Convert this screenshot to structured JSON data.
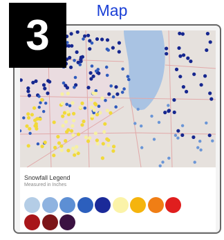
{
  "header": {
    "title": "Map",
    "step_number": "3"
  },
  "map": {
    "colors": {
      "land": "#e6e1dd",
      "land_tint": "#ecd9e2",
      "lake": "#a9c3e3",
      "roads": "#e2a9a9",
      "dot_dark_blue": "#16278f",
      "dot_mid_blue": "#2f5bbd",
      "dot_light_blue": "#6a95d6",
      "dot_yellow": "#f1d93a",
      "dot_pale_yellow": "#f7f0a2"
    }
  },
  "legend": {
    "title": "Snowfall Legend",
    "subtitle": "Measured in Inches",
    "swatches": [
      {
        "label": "",
        "color": "#b4cde6"
      },
      {
        "label": "",
        "color": "#8fb3e0"
      },
      {
        "label": "",
        "color": "#5d8fd4"
      },
      {
        "label": "",
        "color": "#2c5fbd"
      },
      {
        "label": "",
        "color": "#1b2a99"
      },
      {
        "label": "",
        "color": "#fbf3a8"
      },
      {
        "label": "",
        "color": "#f5b40d"
      },
      {
        "label": "",
        "color": "#f07e15"
      },
      {
        "label": "",
        "color": "#e01e1e"
      },
      {
        "label": "",
        "color": "#a8161a"
      },
      {
        "label": "",
        "color": "#7c1518"
      },
      {
        "label": "",
        "color": "#3b1242"
      }
    ]
  }
}
